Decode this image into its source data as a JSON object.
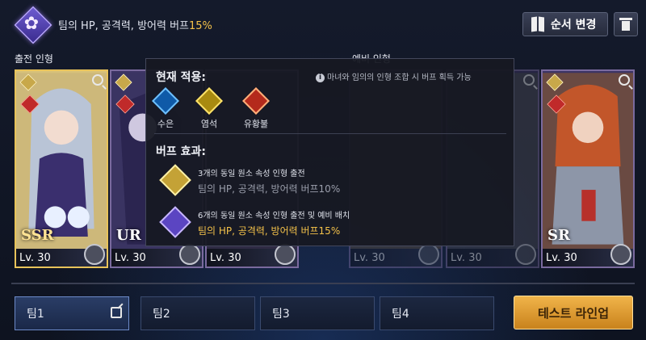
{
  "top": {
    "buff_text": "팀의 HP, 공격력, 방어력 버프",
    "buff_pct": "15%",
    "order_button": "순서 변경"
  },
  "sections": {
    "deploy": "출전 인형",
    "reserve": "예비 인형"
  },
  "cards": [
    {
      "rarity": "SSR",
      "level": "Lv. 30"
    },
    {
      "rarity": "UR",
      "level": "Lv. 30"
    },
    {
      "rarity": "",
      "level": "Lv. 30"
    },
    {
      "rarity": "",
      "level": "Lv. 30"
    },
    {
      "rarity": "",
      "level": "Lv. 30"
    },
    {
      "rarity": "SR",
      "level": "Lv. 30"
    }
  ],
  "popup": {
    "current_title": "현재 적용:",
    "note": "마녀와 임의의 인형 조합 시 버프 획득 가능",
    "elements": [
      "수은",
      "염석",
      "유황불"
    ],
    "effect_title": "버프 효과:",
    "buffs": [
      {
        "condition": "3개의 동일 원소 속성 인형 출전",
        "effect": "팀의 HP, 공격력, 방어력 버프10%"
      },
      {
        "condition": "6개의 동일 원소 속성 인형 출전 및 예비 배치",
        "effect": "팀의 HP, 공격력, 방어력 버프15%"
      }
    ]
  },
  "teams": [
    "팀1",
    "팀2",
    "팀3",
    "팀4"
  ],
  "test_button": "테스트 라인업",
  "colors": {
    "accent_gold": "#f4c24a",
    "active_tab": "#2a3d66"
  }
}
